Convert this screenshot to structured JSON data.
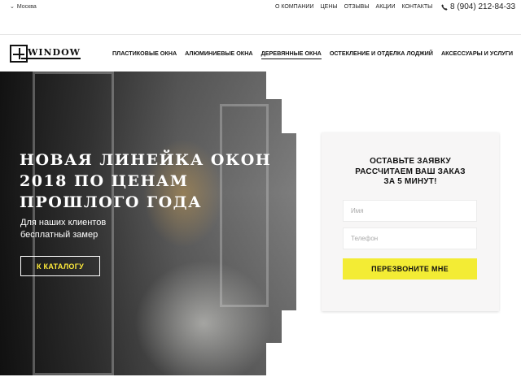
{
  "topbar": {
    "city": "Москва",
    "city_icon": "chevron-down-icon",
    "links": [
      "О КОМПАНИИ",
      "ЦЕНЫ",
      "ОТЗЫВЫ",
      "АКЦИИ",
      "КОНТАКТЫ"
    ],
    "phone": "8 (904) 212-84-33",
    "phone_icon": "phone-icon"
  },
  "logo": {
    "text": "WINDOW"
  },
  "nav": {
    "items": [
      "ПЛАСТИКОВЫЕ ОКНА",
      "АЛЮМИНИЕВЫЕ ОКНА",
      "ДЕРЕВЯННЫЕ ОКНА",
      "ОСТЕКЛЕНИЕ И ОТДЕЛКА ЛОДЖИЙ",
      "АКСЕССУАРЫ И УСЛУГИ"
    ],
    "active_index": 2
  },
  "hero": {
    "title": "НОВАЯ ЛИНЕЙКА ОКОН 2018 ПО ЦЕНАМ ПРОШЛОГО ГОДА",
    "subtitle": "Для наших клиентов бесплатный замер",
    "button": "К КАТАЛОГУ",
    "accent_color": "#ffeb3b"
  },
  "form": {
    "title": "ОСТАВЬТЕ ЗАЯВКУ РАССЧИТАЕМ ВАШ ЗАКАЗ ЗА 5 МИНУТ!",
    "title_lines": [
      "ОСТАВЬТЕ ЗАЯВКУ",
      "РАССЧИТАЕМ ВАШ ЗАКАЗ",
      "ЗА 5 МИНУТ!"
    ],
    "name_placeholder": "Имя",
    "phone_placeholder": "Телефон",
    "submit": "ПЕРЕЗВОНИТЕ МНЕ",
    "submit_color": "#f3ec34"
  }
}
